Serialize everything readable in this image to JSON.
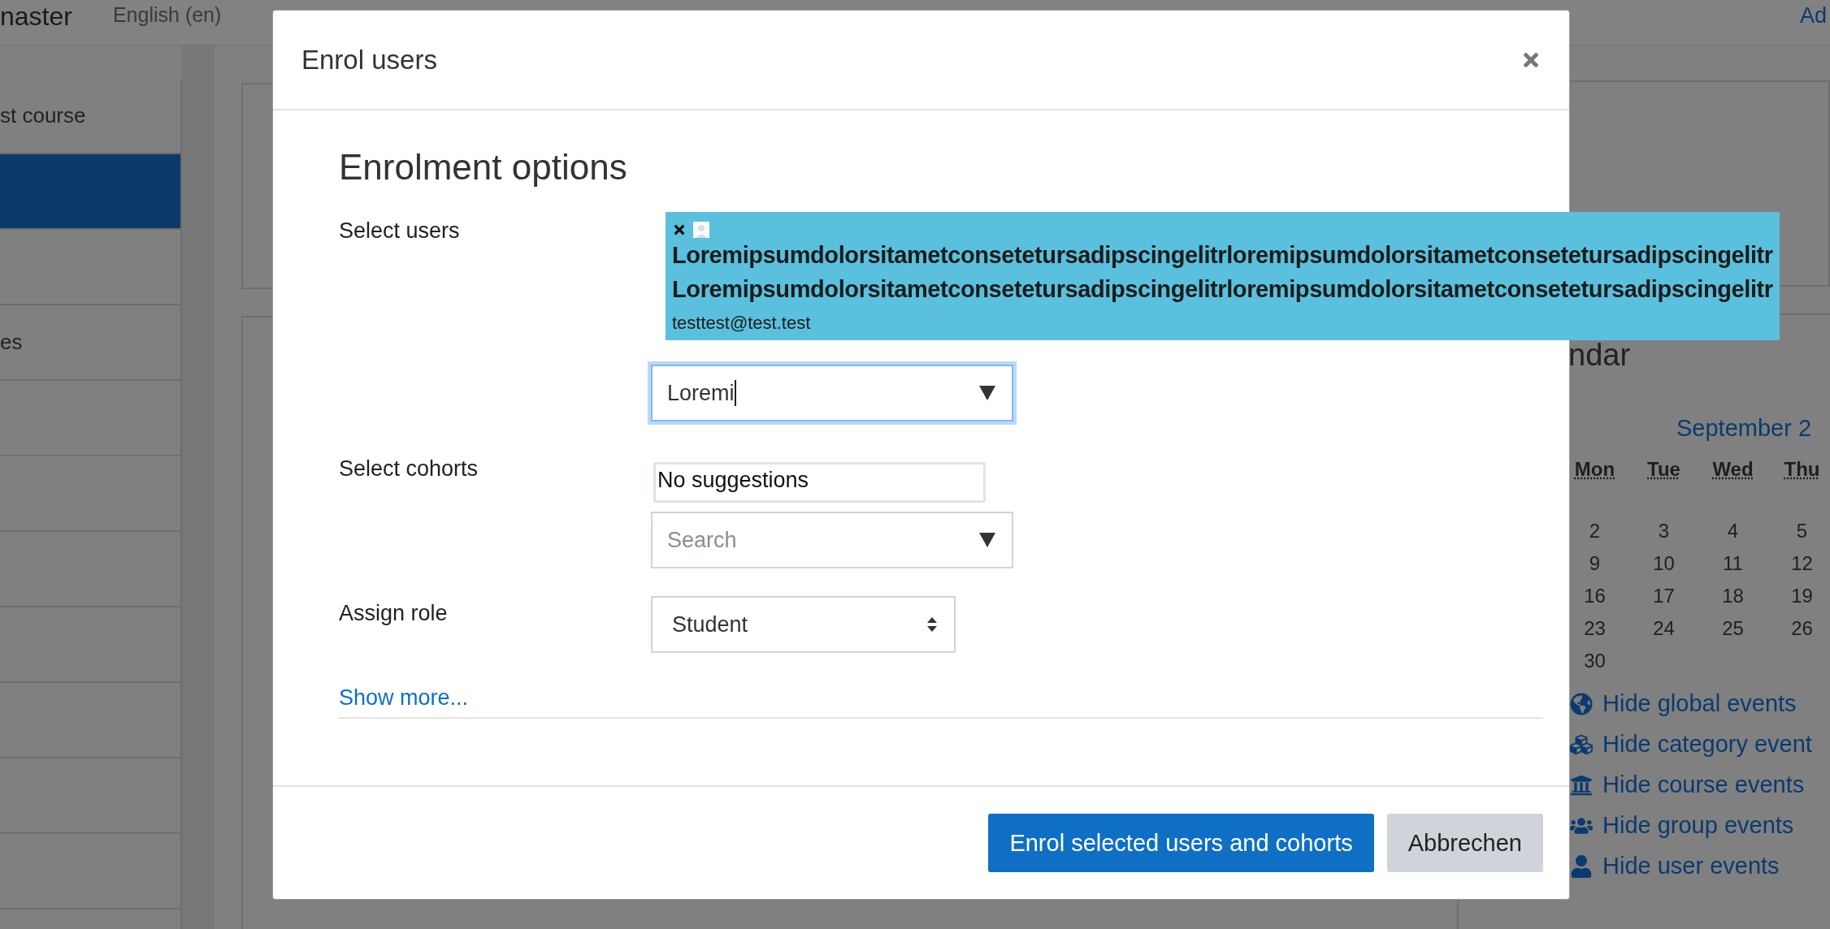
{
  "background": {
    "site_name": "naster",
    "language": "English (en)",
    "top_right": "Ad",
    "sidebar_items": [
      {
        "label": "st course",
        "selected": false
      },
      {
        "selected": true
      },
      {
        "selected": false
      },
      {
        "label": "es",
        "selected": false
      },
      {
        "selected": false
      },
      {
        "selected": false
      },
      {
        "selected": false
      },
      {
        "selected": false
      },
      {
        "selected": false
      },
      {
        "selected": false
      },
      {
        "selected": false
      }
    ],
    "calendar": {
      "title": "ndar",
      "month": "September 2",
      "weekdays": [
        "Mon",
        "Tue",
        "Wed",
        "Thu"
      ],
      "weeks": [
        [
          "2",
          "3",
          "4",
          "5"
        ],
        [
          "9",
          "10",
          "11",
          "12"
        ],
        [
          "16",
          "17",
          "18",
          "19"
        ],
        [
          "23",
          "24",
          "25",
          "26"
        ],
        [
          "30"
        ]
      ],
      "event_links": [
        {
          "kind": "globe",
          "label": "Hide global events"
        },
        {
          "kind": "cubes",
          "label": "Hide category event"
        },
        {
          "kind": "building",
          "label": "Hide course events"
        },
        {
          "kind": "group",
          "label": "Hide group events"
        },
        {
          "kind": "user",
          "label": "Hide user events"
        }
      ]
    }
  },
  "modal": {
    "title": "Enrol users",
    "heading": "Enrolment options",
    "select_users": {
      "label": "Select users",
      "selected_user": {
        "name_lines": [
          "Loremipsumdolorsitametconsetetursadipscingelitrloremipsumdolorsitametconsetetursadipscingelitr",
          "Loremipsumdolorsitametconsetetursadipscingelitrloremipsumdolorsitametconsetetursadipscingelitr"
        ],
        "email": "testtest@test.test"
      },
      "value": "Loremi",
      "suggestions": "No suggestions"
    },
    "select_cohorts": {
      "label": "Select cohorts",
      "placeholder": "Search"
    },
    "assign_role": {
      "label": "Assign role",
      "value": "Student"
    },
    "show_more": "Show more...",
    "buttons": [
      {
        "label": "Enrol selected users and cohorts",
        "kind": "primary"
      },
      {
        "label": "Abbrechen",
        "kind": "secondary"
      }
    ]
  }
}
